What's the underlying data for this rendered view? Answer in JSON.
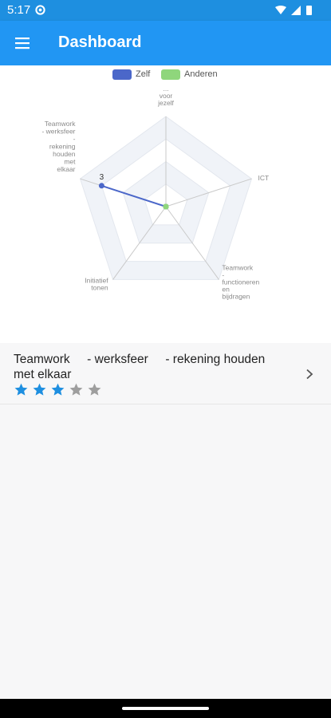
{
  "status_bar": {
    "time": "5:17",
    "icons": [
      "settings-gear-icon",
      "wifi-icon",
      "cellular-signal-icon",
      "battery-icon"
    ],
    "background": "#1e8fe0"
  },
  "app_bar": {
    "title": "Dashboard",
    "menu_icon": "hamburger-menu-icon",
    "background": "#2196f3"
  },
  "chart_data": {
    "type": "radar",
    "axes": [
      {
        "label": [
          "...",
          "voor",
          "jezelf"
        ]
      },
      {
        "label": [
          "ICT"
        ]
      },
      {
        "label": [
          "Teamwork",
          "-",
          "functioneren",
          "en",
          "bijdragen"
        ]
      },
      {
        "label": [
          "Initiatief",
          "tonen"
        ]
      },
      {
        "label": [
          "Teamwork",
          "",
          "- werksfeer",
          "",
          "-",
          "rekening",
          "houden",
          "met",
          "elkaar"
        ]
      }
    ],
    "rlim": [
      0,
      4
    ],
    "rings": 4,
    "series": [
      {
        "name": "Zelf",
        "color": "#4b67c9",
        "values": [
          0,
          0,
          0,
          0,
          3
        ]
      },
      {
        "name": "Anderen",
        "color": "#8fd67c",
        "values": [
          0,
          0,
          0,
          0,
          0
        ]
      }
    ],
    "data_labels": [
      {
        "series": "Zelf",
        "axis": 4,
        "text": "3"
      }
    ],
    "legend_position": "top"
  },
  "list": {
    "items": [
      {
        "title": "Teamwork     - werksfeer     - rekening houden\nmet elkaar",
        "rating": 3,
        "max_rating": 5,
        "star_color": "#1e8fe0",
        "star_empty_color": "#9e9e9e",
        "chevron_icon": "chevron-right-icon"
      }
    ]
  },
  "nav_bar": {
    "handle": "gesture-handle"
  }
}
